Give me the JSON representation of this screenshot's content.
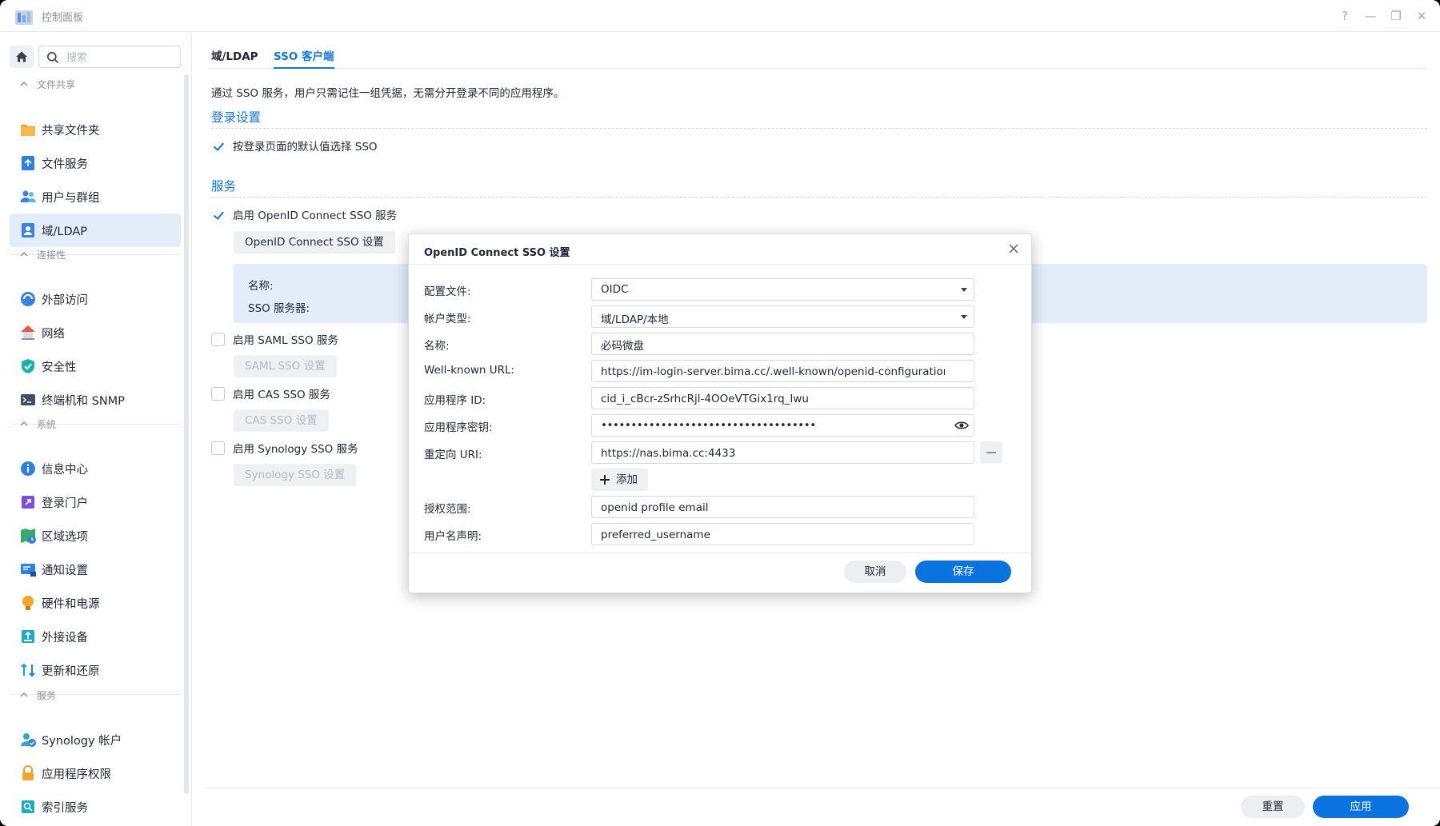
{
  "window": {
    "title": "控制面板"
  },
  "sidebar": {
    "search_placeholder": "搜索",
    "groups": [
      {
        "label": "文件共享",
        "items": [
          {
            "label": "共享文件夹"
          },
          {
            "label": "文件服务"
          },
          {
            "label": "用户与群组"
          },
          {
            "label": "域/LDAP"
          }
        ]
      },
      {
        "label": "连接性",
        "items": [
          {
            "label": "外部访问"
          },
          {
            "label": "网络"
          },
          {
            "label": "安全性"
          },
          {
            "label": "终端机和 SNMP"
          }
        ]
      },
      {
        "label": "系统",
        "items": [
          {
            "label": "信息中心"
          },
          {
            "label": "登录门户"
          },
          {
            "label": "区域选项"
          },
          {
            "label": "通知设置"
          },
          {
            "label": "硬件和电源"
          },
          {
            "label": "外接设备"
          },
          {
            "label": "更新和还原"
          }
        ]
      },
      {
        "label": "服务",
        "items": [
          {
            "label": "Synology 帐户"
          },
          {
            "label": "应用程序权限"
          },
          {
            "label": "索引服务"
          }
        ]
      }
    ],
    "active_item": "域/LDAP"
  },
  "main": {
    "tabs": [
      {
        "label": "域/LDAP"
      },
      {
        "label": "SSO 客户端"
      }
    ],
    "active_tab": "SSO 客户端",
    "description": "通过 SSO 服务，用户只需记住一组凭据，无需分开登录不同的应用程序。",
    "login_section": {
      "title": "登录设置",
      "default_sso_label": "按登录页面的默认值选择 SSO",
      "default_sso_checked": true
    },
    "services_section": {
      "title": "服务",
      "oidc": {
        "label": "启用 OpenID Connect SSO 服务",
        "checked": true,
        "button": "OpenID Connect SSO 设置",
        "info_name_label": "名称:",
        "info_server_label": "SSO 服务器:"
      },
      "saml": {
        "label": "启用 SAML SSO 服务",
        "checked": false,
        "button": "SAML SSO 设置"
      },
      "cas": {
        "label": "启用 CAS SSO 服务",
        "checked": false,
        "button": "CAS SSO 设置"
      },
      "synology": {
        "label": "启用 Synology SSO 服务",
        "checked": false,
        "button": "Synology SSO 设置"
      }
    },
    "footer": {
      "reset_label": "重置",
      "apply_label": "应用"
    }
  },
  "dialog": {
    "title": "OpenID Connect SSO 设置",
    "fields": {
      "profile": {
        "label": "配置文件:",
        "value": "OIDC"
      },
      "account_type": {
        "label": "帐户类型:",
        "value": "域/LDAP/本地"
      },
      "name": {
        "label": "名称:",
        "value": "必码微盘"
      },
      "well_known_url": {
        "label": "Well-known URL:",
        "value": "https://im-login-server.bima.cc/.well-known/openid-configuration"
      },
      "app_id": {
        "label": "应用程序 ID:",
        "value": "cid_i_cBcr-zSrhcRjl-4OOeVTGix1rq_Iwu"
      },
      "app_secret": {
        "label": "应用程序密钥:",
        "value": "••••••••••••••••••••••••••••••••••••"
      },
      "redirect_uri": {
        "label": "重定向 URI:",
        "value": "https://nas.bima.cc:4433"
      },
      "scope": {
        "label": "授权范围:",
        "value": "openid profile email"
      },
      "username_claim": {
        "label": "用户名声明:",
        "value": "preferred_username"
      }
    },
    "add_label": "添加",
    "cancel_label": "取消",
    "save_label": "保存"
  },
  "colors": {
    "accent": "#0a73e0",
    "link": "#1476d8",
    "active_bg": "#e3edf9"
  },
  "icons": [
    "home-icon",
    "search-icon",
    "help-icon",
    "minimize-icon",
    "restore-icon",
    "close-icon",
    "eye-icon"
  ]
}
